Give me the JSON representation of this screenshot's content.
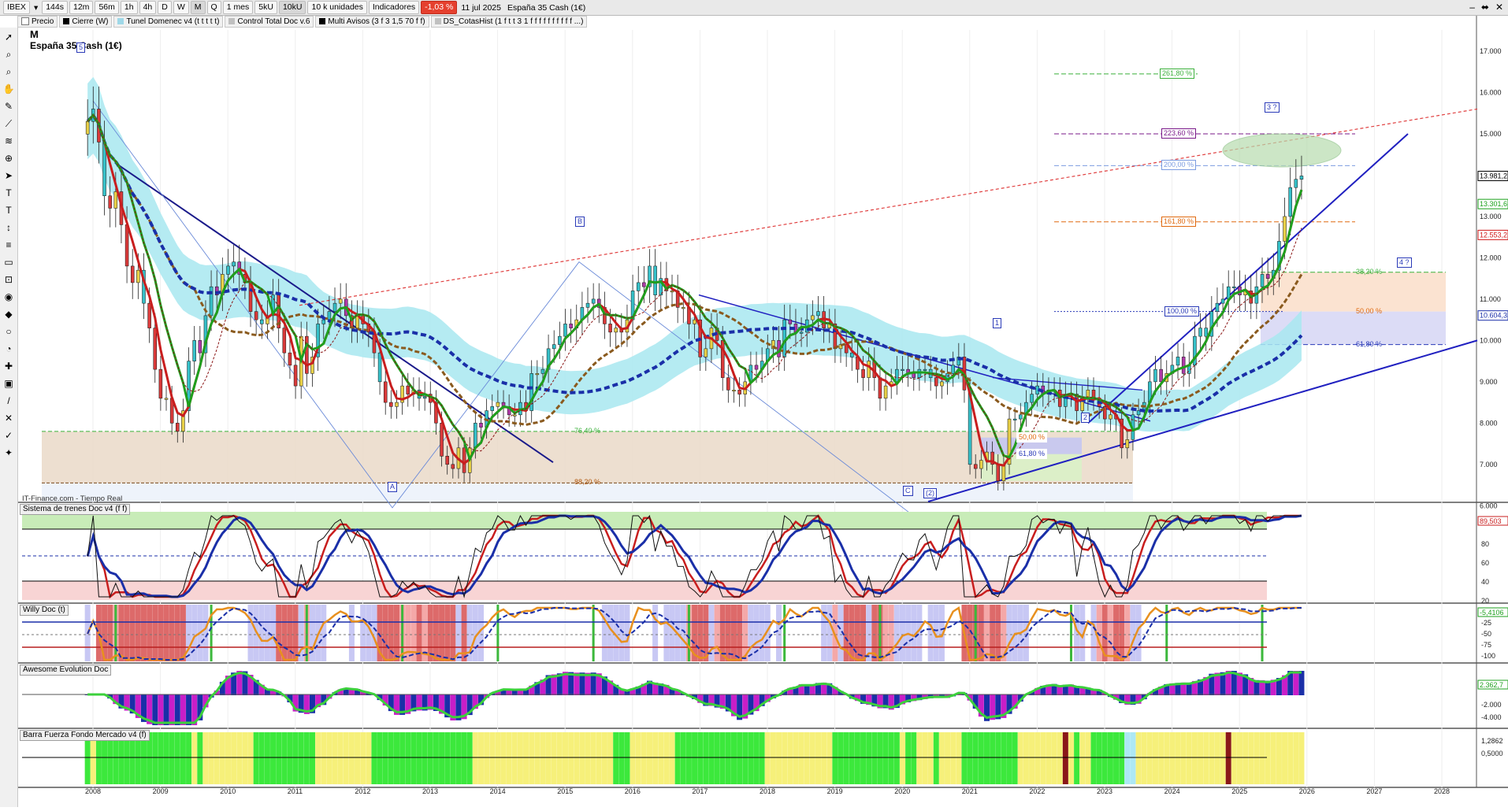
{
  "toolbar": {
    "symbol": "IBEX",
    "items": [
      "144s",
      "12m",
      "56m",
      "1h",
      "4h",
      "D",
      "W",
      "M",
      "Q"
    ],
    "period": "1 mes",
    "items2": [
      "5kU",
      "10kU"
    ],
    "units": "10 k unidades",
    "indicators": "Indicadores",
    "change": "-1,03 %",
    "date": "11 jul 2025",
    "instrument": "España 35 Cash (1€)"
  },
  "legend": {
    "items": [
      "Precio",
      "Cierre (W)",
      "Tunel Domenec v4 (t t t t t)",
      "Control Total Doc v.6",
      "Multi Avisos (3 f 3 1,5 70 f f)",
      "DS_CotasHist (1 f t t 3 1 f f f f f f f f f f ...)"
    ],
    "colors": [
      "#ffffff",
      "#000000",
      "#9fd8e8",
      "#c0c0c0",
      "#000000",
      "#c0c0c0"
    ]
  },
  "main": {
    "period_mark": "M",
    "instrument_name": "España 35 Cash (1€)",
    "source": "IT-Finance.com - Tiempo Real",
    "price_axis": [
      "17.000",
      "16.000",
      "15.000",
      "14.000",
      "13.000",
      "12.000",
      "11.000",
      "10.000",
      "9.000",
      "8.000",
      "7.000",
      "6.000"
    ],
    "price_tags": [
      {
        "text": "13.981,2",
        "color": "#000000"
      },
      {
        "text": "13.301,6",
        "color": "#19a019"
      },
      {
        "text": "12.553,2",
        "color": "#d01818"
      },
      {
        "text": "10.604,3",
        "color": "#1a2fa8"
      }
    ],
    "fib_labels": [
      {
        "text": "261,80 %",
        "color": "#3bb03b"
      },
      {
        "text": "223,60 %",
        "color": "#7a1a8a"
      },
      {
        "text": "200,00 %",
        "color": "#7c9ce0"
      },
      {
        "text": "161,80 %",
        "color": "#e06a10"
      },
      {
        "text": "100,00 %",
        "color": "#2a3ab8"
      },
      {
        "text": "38,20 %",
        "color": "#3bb03b"
      },
      {
        "text": "50,00 %",
        "color": "#e06a10"
      },
      {
        "text": "61,80 %",
        "color": "#2a3ab8"
      },
      {
        "text": "76,40 %",
        "color": "#3bb03b"
      },
      {
        "text": "88,20 %",
        "color": "#b0570f"
      },
      {
        "text": "50,00 %",
        "color": "#e06a10"
      },
      {
        "text": "61,80 %",
        "color": "#2a3ab8"
      }
    ],
    "wave_labels": [
      "5",
      "B",
      "A",
      "C",
      "(2)",
      "1",
      "2",
      "3 ?",
      "4 ?"
    ]
  },
  "panels": {
    "trenes": {
      "title": "Sistema de trenes Doc v4 (f f)",
      "axis": [
        "80",
        "60",
        "40",
        "20"
      ],
      "tags": [
        "89,503"
      ]
    },
    "willy": {
      "title": "Willy Doc (t)",
      "axis": [
        "-25",
        "-50",
        "-75",
        "-100"
      ],
      "tags": [
        "-5,4106"
      ]
    },
    "awesome": {
      "title": "Awesome Evolution Doc",
      "axis": [
        "-2.000",
        "-4.000"
      ],
      "tags": [
        "2.362,7"
      ]
    },
    "barra": {
      "title": "Barra Fuerza Fondo Mercado v4 (f)",
      "axis": [
        "1,2862",
        "0,5000"
      ],
      "tags": [
        "1,2862",
        "0,5000"
      ]
    }
  },
  "xaxis": [
    "2008",
    "2009",
    "2010",
    "2011",
    "2012",
    "2013",
    "2014",
    "2015",
    "2016",
    "2017",
    "2018",
    "2019",
    "2020",
    "2021",
    "2022",
    "2023",
    "2024",
    "2025",
    "2026",
    "2027",
    "2028"
  ],
  "chart_data": {
    "type": "candlestick",
    "title": "España 35 Cash (1€)",
    "timeframe": "monthly",
    "ylim": [
      5500,
      17200
    ],
    "closes_by_year_end": {
      "2007": 15200,
      "2008": 9200,
      "2009": 11900,
      "2010": 9900,
      "2011": 8600,
      "2012": 8200,
      "2013": 9900,
      "2014": 10300,
      "2015": 9500,
      "2016": 9350,
      "2017": 10050,
      "2018": 8550,
      "2019": 9550,
      "2020": 8070,
      "2021": 8700,
      "2022": 8230,
      "2023": 10100,
      "2024": 11590,
      "2025": 13981
    }
  }
}
